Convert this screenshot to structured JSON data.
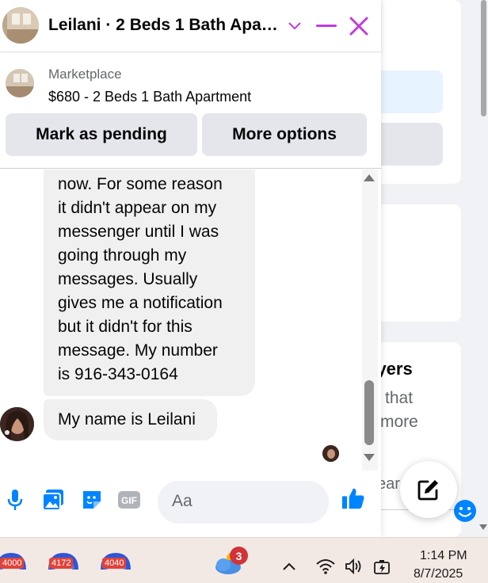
{
  "header": {
    "title": "Leilani · 2 Beds 1 Bath Apa…",
    "avatar_icon": "apartment-photo-avatar",
    "chevron_icon": "chevron-down-icon",
    "minimize_icon": "minimize-icon",
    "close_icon": "close-icon",
    "accent_color": "#c13be0"
  },
  "listing": {
    "source": "Marketplace",
    "title": "$680 - 2 Beds 1 Bath Apartment",
    "pending_label": "Mark as pending",
    "more_label": "More options"
  },
  "messages": [
    {
      "text": "you message only just\nnow. For some reason\nit didn't appear on my\nmessenger until I was\ngoing through my\nmessages. Usually\ngives me a notification\nbut it didn't for this\nmessage. My number\nis 916-343-0164"
    },
    {
      "text": "My name is Leilani"
    }
  ],
  "composer": {
    "placeholder": "Aa",
    "icons": [
      "microphone-icon",
      "photo-icon",
      "sticker-icon",
      "gif-icon",
      "emoji-icon",
      "thumbs-up-icon"
    ],
    "gif_label": "GIF",
    "accent_color": "#0084ff"
  },
  "background_page": {
    "heading": "uyers",
    "line1": "that",
    "line2": "more",
    "search_text": "ear"
  },
  "taskbar": {
    "apps": [
      {
        "badge": "4000"
      },
      {
        "badge": "4172"
      },
      {
        "badge": "4040"
      }
    ],
    "weather_badge": "3",
    "time": "1:14 PM",
    "date": "8/7/2025"
  }
}
